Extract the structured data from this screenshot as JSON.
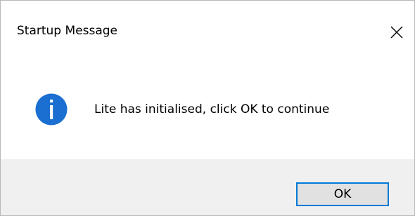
{
  "window": {
    "title": "Startup Message",
    "close_icon": "close-icon"
  },
  "content": {
    "icon": "info-icon",
    "icon_glyph": "i",
    "icon_color": "#1a6fd1",
    "message": "Lite has initialised, click OK to continue"
  },
  "footer": {
    "ok_label": "OK",
    "accent_color": "#0078d7"
  }
}
